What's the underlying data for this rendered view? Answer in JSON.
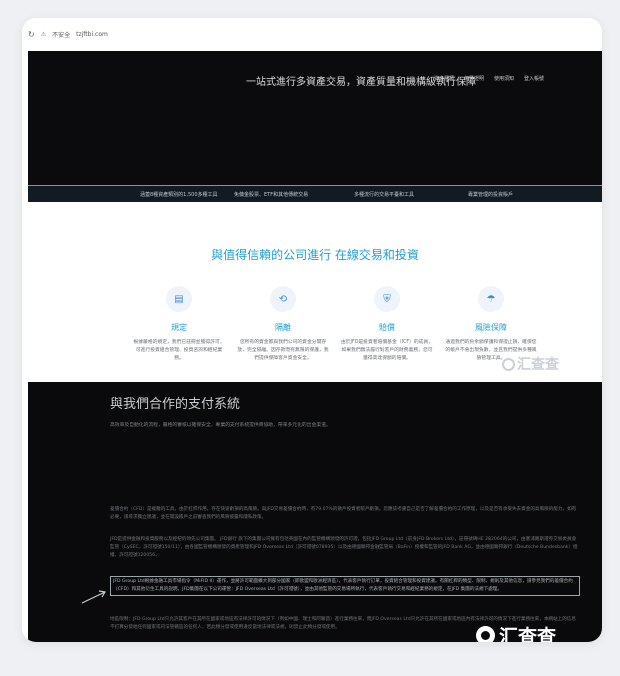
{
  "browser": {
    "security_label": "不安全",
    "url": "tzjftbi.com"
  },
  "hero": {
    "title": "一站式進行多資產交易，資產質量和機構級執行保障",
    "nav": [
      "資產種類",
      "免費證明",
      "使用須知",
      "登入帳號"
    ]
  },
  "strip": {
    "items": [
      "涵蓋8種資產類別的1,500多種工具",
      "免傭金股票、ETF和其他傳統交易",
      "多種流行的交易平臺和工具",
      "專業管理的投資賬戶"
    ]
  },
  "trust": {
    "title": "與值得信賴的公司進行 在線交易和投資",
    "features": [
      {
        "icon": "document-check-icon",
        "glyph": "▤",
        "title": "規定",
        "desc": "根據嚴格的規定，我們已註冊並獲得許可，可進行投資組合管理、投資咨詢和經紀業務。"
      },
      {
        "icon": "handshake-icon",
        "glyph": "⟲",
        "title": "隔離",
        "desc": "您所有的資金都與我們公司的資金分開存放，完全隔離。因存款而有無限的保護，我們提供保障客戶資金安全。"
      },
      {
        "icon": "shield-device-icon",
        "glyph": "⛨",
        "title": "賠償",
        "desc": "由於JFD是投資者賠償基金（ICF）的成員，如果我們無法履行對客戶的財務義務，您可獲得高達保額的賠償。"
      },
      {
        "icon": "umbrella-icon",
        "glyph": "☂",
        "title": "風險保障",
        "desc": "通過我們的負余額保護和保證止損，確保您的帳戶不會出現負數，並且我們提供多種風險管理工具。"
      }
    ]
  },
  "watermark": {
    "text": "汇查查"
  },
  "payments": {
    "title": "與我們合作的支付系統",
    "subtitle": "高效率及自動化的流程，嚴格的審核以確保安全，專業的支付系統提供商協助，帶來多元化的出金渠道。",
    "paragraphs": [
      "差價合約（CFD）是複雜的工具，由於杠桿作用，存在快速虧損的高風險。與JFD交易差價合約時，有79.07%的散戶投資者賬戶虧損。您應該考慮自己是否了解差價合約的工作原理，以及是否有承受失去資金的高風險的能力。如有必要，請尋求獨立建議，並在開設帳戶之前審查我們的風險披露和隱私政策。",
      "JFD是提供金融和投資服務以及經紀的領先公司集團。 JFD銀行 旗下的集團公司擁有包括英國在內的監管機構頒發的許可證，包括JFD Group Ltd（前身JFD Brokers Ltd），註冊號碼HE 282064的公司，由塞浦路斯證券交易委員會監管（CySEC，許可證號150/11），由各國監管機構頒發的資產管理和JFD Overseas Ltd（許可證號078935）以及由德國聯邦金融監管局（BaFin）授權和監管的JFD Bank AG，並由德國聯邦銀行（Deutsche Bundesbank）授權，許可證號120056。",
      "JFD Group Ltd根據金融工具市場指令（MiFID II）運作，並將許可範圍擴大到部分國家（即歐盟和歐洲經濟區），代表客戶執行訂單，投資組合管理和投資建議。有關杠桿的類型、限制、規則及其他信息，請參見我們的差價合約（CFD）和其他衍生工具的說明。JFD集團在以下公司運營：JFD Overseas Ltd（許可證號），並由其他監管的交易場所執行，代表客戶執行交易和經紀業務的規定，在JFD 集團的法規下處理。",
      "地區限制：JFD Group Ltd只允許其客戶在其所在國家或地區有法律許可的情況下（例如中國、瑞士和阿聯酋）進行業務往來，而JFD Overseas Ltd只允許在其所在國家或地區內有法律許可的情況下進行業務往來，本網站上的信息不打算分發給任何國家或司法管轄區的任何人，若此類分發或使用違反當地法律或法規，則禁止此類分發或使用。"
    ]
  }
}
